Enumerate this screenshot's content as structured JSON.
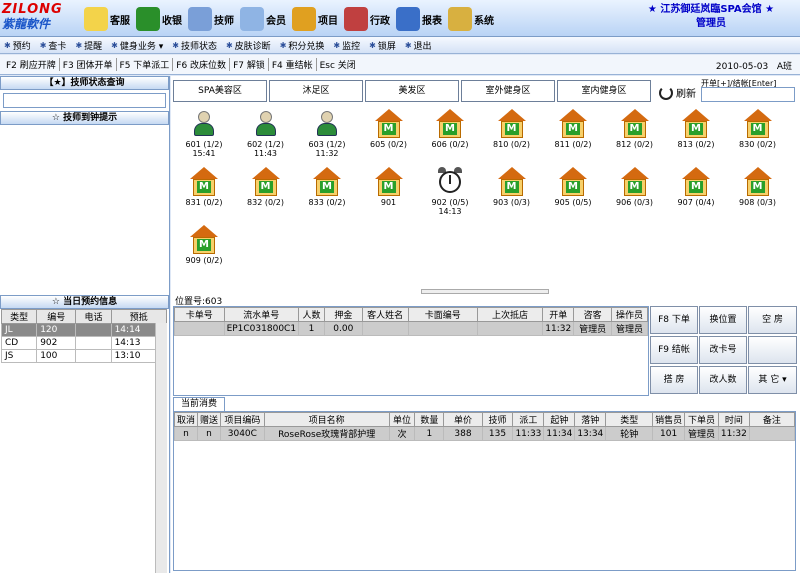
{
  "app": {
    "logo_top": "ZILONG",
    "logo_bottom": "紫龍軟件",
    "title_line1": "★ 江苏御廷岚臨SPA会馆 ★",
    "title_line2": "管理员"
  },
  "main_menu": [
    {
      "label": "客服",
      "icon": "customer-service-icon",
      "color": "#f3d34a"
    },
    {
      "label": "收银",
      "icon": "money-bag-icon",
      "color": "#2a8f2a"
    },
    {
      "label": "技师",
      "icon": "technician-icon",
      "color": "#7a9fd8"
    },
    {
      "label": "会员",
      "icon": "handshake-icon",
      "color": "#8fb4e4"
    },
    {
      "label": "项目",
      "icon": "project-icon",
      "color": "#e0a020"
    },
    {
      "label": "行政",
      "icon": "admin-icon",
      "color": "#c04040"
    },
    {
      "label": "报表",
      "icon": "report-icon",
      "color": "#3a6fc8"
    },
    {
      "label": "系统",
      "icon": "lock-icon",
      "color": "#d8b040"
    }
  ],
  "toolbar2": [
    "预约",
    "查卡",
    "提醒",
    "健身业务 ▾",
    "技师状态",
    "皮肤诊断",
    "积分兑换",
    "监控",
    "锁屏",
    "退出"
  ],
  "shortcuts": [
    "F2 刷应开牌",
    "F3 团体开单",
    "F5 下单派工",
    "F6 改床位数",
    "F7 解锁",
    "F4 重结帐",
    "Esc 关闭"
  ],
  "date": "2010-05-03",
  "date_suffix": "A班",
  "left": {
    "tech_query_title": "【★】技师状态查询",
    "tech_reminder_title": "☆ 技师到钟提示",
    "appointment_title": "☆ 当日预约信息",
    "appointment_headers": [
      "类型",
      "编号",
      "电话",
      "预抵"
    ],
    "appointments": [
      {
        "type": "JL",
        "id": "120",
        "phone": "",
        "time": "14:14"
      },
      {
        "type": "CD",
        "id": "902",
        "phone": "",
        "time": "14:13"
      },
      {
        "type": "JS",
        "id": "100",
        "phone": "",
        "time": "13:10"
      }
    ]
  },
  "area_tabs": [
    "SPA美容区",
    "沐足区",
    "美发区",
    "室外健身区",
    "室内健身区"
  ],
  "refresh_label": "刷新",
  "kaidan_label": "开单[+]/结帐[Enter]",
  "rooms": [
    {
      "name": "601 (1/2)",
      "time": "15:41",
      "kind": "person"
    },
    {
      "name": "602 (1/2)",
      "time": "11:43",
      "kind": "person"
    },
    {
      "name": "603 (1/2)",
      "time": "11:32",
      "kind": "person"
    },
    {
      "name": "605 (0/2)",
      "time": "",
      "kind": "house"
    },
    {
      "name": "606 (0/2)",
      "time": "",
      "kind": "house"
    },
    {
      "name": "810 (0/2)",
      "time": "",
      "kind": "house"
    },
    {
      "name": "811 (0/2)",
      "time": "",
      "kind": "house"
    },
    {
      "name": "812 (0/2)",
      "time": "",
      "kind": "house"
    },
    {
      "name": "813 (0/2)",
      "time": "",
      "kind": "house"
    },
    {
      "name": "830 (0/2)",
      "time": "",
      "kind": "house"
    },
    {
      "name": "831 (0/2)",
      "time": "",
      "kind": "house"
    },
    {
      "name": "832 (0/2)",
      "time": "",
      "kind": "house"
    },
    {
      "name": "833 (0/2)",
      "time": "",
      "kind": "house"
    },
    {
      "name": "901",
      "time": "",
      "kind": "house"
    },
    {
      "name": "902 (0/5)",
      "time": "14:13",
      "kind": "clock"
    },
    {
      "name": "903 (0/3)",
      "time": "",
      "kind": "house"
    },
    {
      "name": "905 (0/5)",
      "time": "",
      "kind": "house"
    },
    {
      "name": "906 (0/3)",
      "time": "",
      "kind": "house"
    },
    {
      "name": "907 (0/4)",
      "time": "",
      "kind": "house"
    },
    {
      "name": "908 (0/3)",
      "time": "",
      "kind": "house"
    },
    {
      "name": "909 (0/2)",
      "time": "",
      "kind": "house"
    }
  ],
  "room_label": "位置号:603",
  "order_headers": [
    "卡单号",
    "流水单号",
    "人数",
    "押金",
    "客人姓名",
    "卡面编号",
    "上次抵店",
    "开单",
    "咨客",
    "操作员"
  ],
  "orders": [
    {
      "card": "",
      "serial": "EP1C031800C1",
      "people": "1",
      "deposit": "0.00",
      "guest": "",
      "card_no": "",
      "last_visit": "",
      "open": "11:32",
      "consultant": "管理员",
      "operator": "管理员"
    }
  ],
  "buttons": [
    "F8 下单",
    "换位置",
    "空 房",
    "F9 结帐",
    "改卡号",
    "",
    "搭 房",
    "改人数",
    "其 它 ▾"
  ],
  "consume_tab": "当前消费",
  "consume_headers": [
    "取消",
    "赠送",
    "项目编码",
    "项目名称",
    "单位",
    "数量",
    "单价",
    "技师",
    "派工",
    "起钟",
    "落钟",
    "类型",
    "销售员",
    "下单员",
    "时间",
    "备注"
  ],
  "consumes": [
    {
      "cancel": "n",
      "gift": "n",
      "code": "3040C",
      "name": "RoseRose玫瑰背部护理",
      "unit": "次",
      "qty": "1",
      "price": "388",
      "tech": "135",
      "dispatch": "11:33",
      "start": "11:34",
      "end": "13:34",
      "type": "轮钟",
      "seller": "101",
      "orderer": "管理员",
      "time": "11:32",
      "note": ""
    }
  ]
}
